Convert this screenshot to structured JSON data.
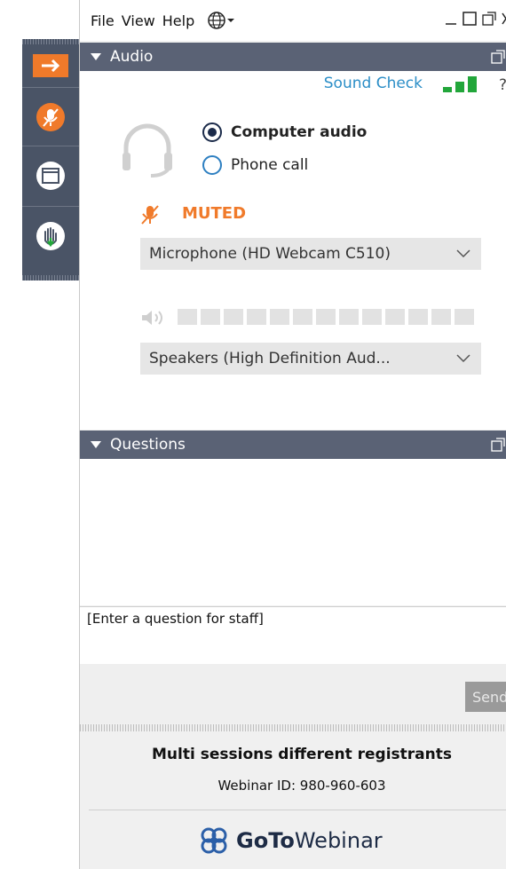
{
  "menu": {
    "file": "File",
    "view": "View",
    "help": "Help"
  },
  "audio": {
    "title": "Audio",
    "sound_check": "Sound Check",
    "help": "?",
    "options": [
      "Computer audio",
      "Phone call"
    ],
    "selected": "Computer audio",
    "muted": "MUTED",
    "microphone": "Microphone (HD Webcam C510)",
    "speakers": "Speakers (High Definition Aud...",
    "level_segments": 13
  },
  "questions": {
    "title": "Questions",
    "placeholder": "[Enter a question for staff]",
    "send": "Send"
  },
  "footer": {
    "session_title": "Multi sessions different registrants",
    "webinar_id": "Webinar ID: 980-960-603",
    "logo_goto": "GoTo",
    "logo_webinar": "Webinar"
  },
  "colors": {
    "accent_orange": "#f07a2a",
    "header_bg": "#5a6275",
    "toolbar_bg": "#4a5466",
    "link_blue": "#2b8ec7",
    "signal_green": "#22a63a"
  },
  "icons": [
    "arrow-right-icon",
    "mic-muted-icon",
    "window-icon",
    "raise-hand-icon",
    "globe-icon",
    "headset-icon",
    "speaker-icon",
    "chevron-down-icon",
    "popout-icon",
    "goto-logo-icon"
  ]
}
